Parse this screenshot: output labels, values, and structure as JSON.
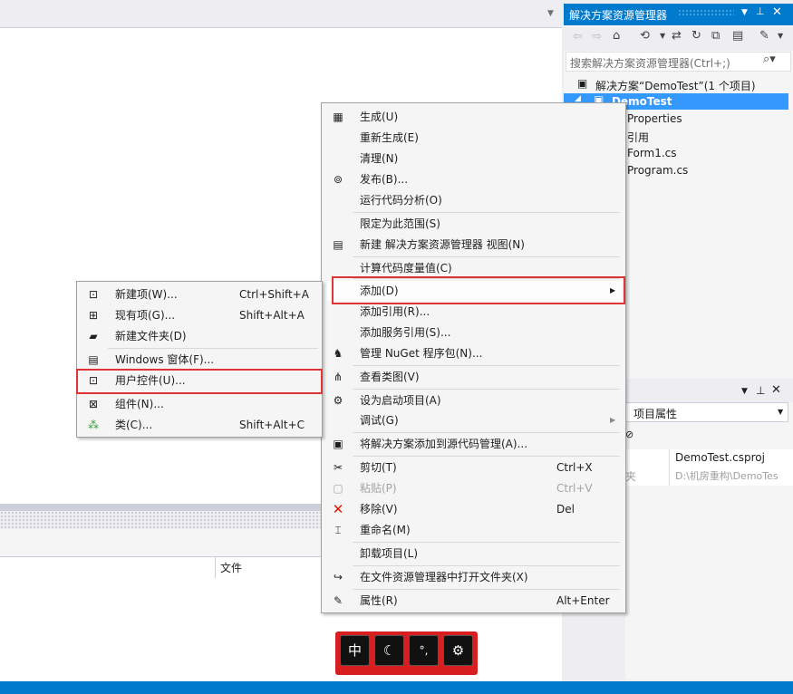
{
  "colors": {
    "accent": "#007acc",
    "highlight": "#3399ff",
    "outline": "#e03535",
    "ime": "#d81e1e"
  },
  "error_list": {
    "col_file": "文件"
  },
  "solution_explorer": {
    "title": "解决方案资源管理器",
    "search_placeholder": "搜索解决方案资源管理器(Ctrl+;)",
    "solution": "解决方案“DemoTest”(1 个项目)",
    "project": "DemoTest",
    "children": [
      "Properties",
      "引用",
      "Form1.cs",
      "Program.cs"
    ]
  },
  "properties": {
    "combo": "项目属性",
    "rows": [
      {
        "name": "",
        "value": "DemoTest.csproj"
      },
      {
        "name": "夹",
        "value": "D:\\机房重构\\DemoTes"
      }
    ]
  },
  "context_menu": {
    "items": [
      {
        "icon": "build-icon",
        "label": "生成(U)",
        "shortcut": ""
      },
      {
        "icon": "",
        "label": "重新生成(E)",
        "shortcut": ""
      },
      {
        "icon": "",
        "label": "清理(N)",
        "shortcut": ""
      },
      {
        "icon": "publish-icon",
        "label": "发布(B)...",
        "shortcut": ""
      },
      {
        "icon": "",
        "label": "运行代码分析(O)",
        "shortcut": ""
      },
      {
        "icon": "",
        "label": "限定为此范围(S)",
        "shortcut": ""
      },
      {
        "icon": "new-view-icon",
        "label": "新建 解决方案资源管理器 视图(N)",
        "shortcut": ""
      },
      {
        "icon": "",
        "label": "计算代码度量值(C)",
        "shortcut": ""
      },
      {
        "icon": "",
        "label": "添加(D)",
        "shortcut": ""
      },
      {
        "icon": "",
        "label": "添加引用(R)...",
        "shortcut": ""
      },
      {
        "icon": "",
        "label": "添加服务引用(S)...",
        "shortcut": ""
      },
      {
        "icon": "nuget-icon",
        "label": "管理 NuGet 程序包(N)...",
        "shortcut": ""
      },
      {
        "icon": "class-view-icon",
        "label": "查看类图(V)",
        "shortcut": ""
      },
      {
        "icon": "gear-icon",
        "label": "设为启动项目(A)",
        "shortcut": ""
      },
      {
        "icon": "",
        "label": "调试(G)",
        "shortcut": ""
      },
      {
        "icon": "source-control-icon",
        "label": "将解决方案添加到源代码管理(A)...",
        "shortcut": ""
      },
      {
        "icon": "scissors-icon",
        "label": "剪切(T)",
        "shortcut": "Ctrl+X"
      },
      {
        "icon": "paste-icon",
        "label": "粘贴(P)",
        "shortcut": "Ctrl+V"
      },
      {
        "icon": "delete-icon",
        "label": "移除(V)",
        "shortcut": "Del"
      },
      {
        "icon": "rename-icon",
        "label": "重命名(M)",
        "shortcut": ""
      },
      {
        "icon": "",
        "label": "卸载项目(L)",
        "shortcut": ""
      },
      {
        "icon": "open-folder-icon",
        "label": "在文件资源管理器中打开文件夹(X)",
        "shortcut": ""
      },
      {
        "icon": "wrench-icon",
        "label": "属性(R)",
        "shortcut": "Alt+Enter"
      }
    ]
  },
  "add_submenu": {
    "items": [
      {
        "icon": "new-item-icon",
        "label": "新建项(W)...",
        "shortcut": "Ctrl+Shift+A"
      },
      {
        "icon": "existing-item-icon",
        "label": "现有项(G)...",
        "shortcut": "Shift+Alt+A"
      },
      {
        "icon": "new-folder-icon",
        "label": "新建文件夹(D)",
        "shortcut": ""
      },
      {
        "icon": "windows-form-icon",
        "label": "Windows 窗体(F)...",
        "shortcut": ""
      },
      {
        "icon": "user-control-icon",
        "label": "用户控件(U)...",
        "shortcut": ""
      },
      {
        "icon": "component-icon",
        "label": "组件(N)...",
        "shortcut": ""
      },
      {
        "icon": "class-icon",
        "label": "类(C)...",
        "shortcut": "Shift+Alt+C"
      }
    ]
  },
  "ime_bar": {
    "lang": "中",
    "moon": "☾",
    "punct": "°,",
    "settings": "⚙"
  }
}
